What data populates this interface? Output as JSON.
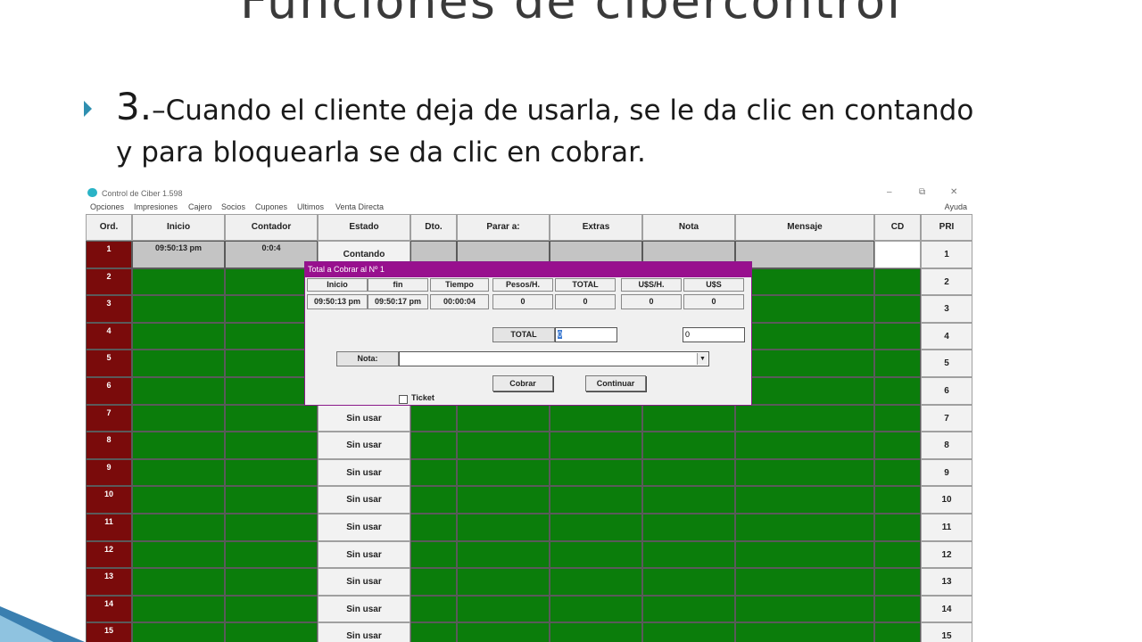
{
  "slide": {
    "title": "Funciones de cibercontrol",
    "step_number": "3.",
    "text_line1": "–Cuando el cliente deja de usarla, se le da clic en contando",
    "text_line2": "y para bloquearla se da clic en cobrar."
  },
  "window": {
    "title": "Control de Ciber 1.598",
    "minimize": "–",
    "maximize": "⧉",
    "close": "✕",
    "menu": [
      "Opciones",
      "Impresiones",
      "Cajero",
      "Socios",
      "Cupones",
      "Ultimos",
      "Venta Directa"
    ],
    "help": "Ayuda"
  },
  "grid": {
    "headers": [
      "Ord.",
      "Inicio",
      "Contador",
      "Estado",
      "Dto.",
      "Parar a:",
      "Extras",
      "Nota",
      "Mensaje",
      "CD",
      "PRI"
    ],
    "rows": [
      {
        "ord": "1",
        "inicio": "09:50:13 pm",
        "contador": "0:0:4",
        "estado": "Contando",
        "pri": "1"
      },
      {
        "ord": "2",
        "inicio": "",
        "contador": "",
        "estado": "",
        "pri": "2"
      },
      {
        "ord": "3",
        "inicio": "",
        "contador": "",
        "estado": "",
        "pri": "3"
      },
      {
        "ord": "4",
        "inicio": "",
        "contador": "",
        "estado": "",
        "pri": "4"
      },
      {
        "ord": "5",
        "inicio": "",
        "contador": "",
        "estado": "",
        "pri": "5"
      },
      {
        "ord": "6",
        "inicio": "",
        "contador": "",
        "estado": "",
        "pri": "6"
      },
      {
        "ord": "7",
        "inicio": "",
        "contador": "",
        "estado": "Sin usar",
        "pri": "7"
      },
      {
        "ord": "8",
        "inicio": "",
        "contador": "",
        "estado": "Sin usar",
        "pri": "8"
      },
      {
        "ord": "9",
        "inicio": "",
        "contador": "",
        "estado": "Sin usar",
        "pri": "9"
      },
      {
        "ord": "10",
        "inicio": "",
        "contador": "",
        "estado": "Sin usar",
        "pri": "10"
      },
      {
        "ord": "11",
        "inicio": "",
        "contador": "",
        "estado": "Sin usar",
        "pri": "11"
      },
      {
        "ord": "12",
        "inicio": "",
        "contador": "",
        "estado": "Sin usar",
        "pri": "12"
      },
      {
        "ord": "13",
        "inicio": "",
        "contador": "",
        "estado": "Sin usar",
        "pri": "13"
      },
      {
        "ord": "14",
        "inicio": "",
        "contador": "",
        "estado": "Sin usar",
        "pri": "14"
      },
      {
        "ord": "15",
        "inicio": "",
        "contador": "",
        "estado": "Sin usar",
        "pri": "15"
      }
    ]
  },
  "dialog": {
    "title": "Total a Cobrar al Nº 1",
    "headers": [
      "Inicio",
      "fin",
      "Tiempo",
      "Pesos/H.",
      "TOTAL",
      "U$S/H.",
      "U$S"
    ],
    "values": [
      "09:50:13 pm",
      "09:50:17 pm",
      "00:00:04",
      "0",
      "0",
      "0",
      "0"
    ],
    "total_label": "TOTAL",
    "total_value": "0",
    "usd_value": "0",
    "nota_label": "Nota:",
    "nota_value": "",
    "cobrar_button": "Cobrar",
    "continuar_button": "Continuar",
    "ticket_label": "Ticket"
  },
  "colors": {
    "ord_column": "#7a0b0b",
    "free_cell": "#0b7d0b",
    "active_row": "#c4c4c4",
    "dialog_title": "#98108e"
  }
}
